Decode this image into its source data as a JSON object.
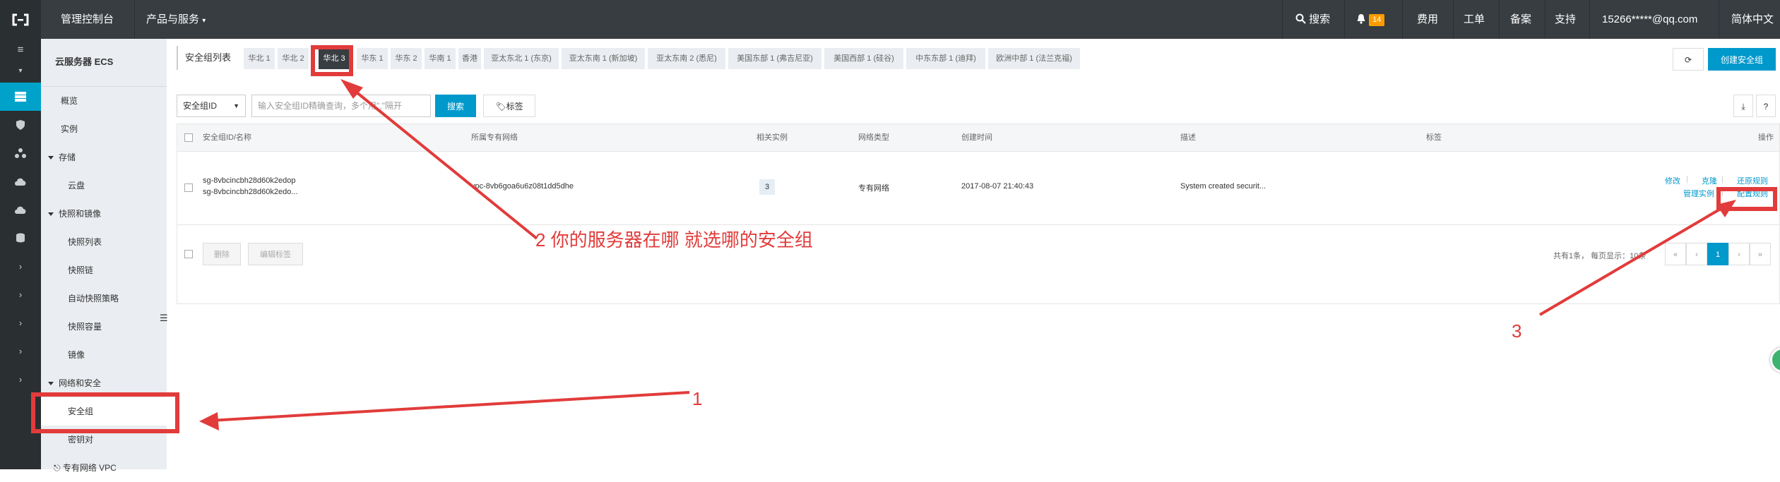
{
  "topbar": {
    "console": "管理控制台",
    "products": "产品与服务",
    "search": "搜索",
    "notifications_count": "14",
    "billing": "费用",
    "tickets": "工单",
    "icp": "备案",
    "support": "支持",
    "account": "15266*****@qq.com",
    "language": "简体中文"
  },
  "sidebar": {
    "title": "云服务器 ECS",
    "items": [
      {
        "label": "概览",
        "indent": 1
      },
      {
        "label": "实例",
        "indent": 1
      },
      {
        "label": "存储",
        "indent": 0,
        "group": true
      },
      {
        "label": "云盘",
        "indent": 2
      },
      {
        "label": "快照和镜像",
        "indent": 0,
        "group": true
      },
      {
        "label": "快照列表",
        "indent": 2
      },
      {
        "label": "快照链",
        "indent": 2
      },
      {
        "label": "自动快照策略",
        "indent": 2
      },
      {
        "label": "快照容量",
        "indent": 2
      },
      {
        "label": "镜像",
        "indent": 2
      },
      {
        "label": "网络和安全",
        "indent": 0,
        "group": true
      },
      {
        "label": "安全组",
        "indent": 2
      },
      {
        "label": "密钥对",
        "indent": 2
      },
      {
        "label": "专有网络 VPC",
        "indent": 2
      }
    ]
  },
  "region_bar": {
    "title": "安全组列表",
    "tabs": [
      "华北 1",
      "华北 2",
      "华北 3",
      "华东 1",
      "华东 2",
      "华南 1",
      "香港",
      "亚太东北 1 (东京)",
      "亚太东南 1 (新加坡)",
      "亚太东南 2 (悉尼)",
      "美国东部 1 (弗吉尼亚)",
      "美国西部 1 (硅谷)",
      "中东东部 1 (迪拜)",
      "欧洲中部 1 (法兰克福)"
    ],
    "active_tab": "华北 3",
    "refresh_icon": "refresh-icon",
    "create_button": "创建安全组"
  },
  "filters": {
    "select_value": "安全组ID",
    "search_placeholder": "输入安全组ID精确查询，多个用\",\"隔开",
    "search_button": "搜索",
    "tag_button": "标签"
  },
  "table": {
    "columns": [
      "安全组ID/名称",
      "所属专有网络",
      "相关实例",
      "网络类型",
      "创建时间",
      "描述",
      "标签",
      "操作"
    ],
    "rows": [
      {
        "id": "sg-8vbcincbh28d60k2edop",
        "name": "sg-8vbcincbh28d60k2edo...",
        "vpc": "vpc-8vb6goa6u6z08t1dd5dhe",
        "instances": "3",
        "network_type": "专有网络",
        "created": "2017-08-07 21:40:43",
        "description": "System created securit...",
        "tags": "",
        "actions": [
          "修改",
          "克隆",
          "还原规则",
          "管理实例",
          "配置规则"
        ]
      }
    ],
    "footer_buttons": [
      "删除",
      "编辑标签"
    ],
    "summary": "共有1条， 每页显示：10条",
    "pager": [
      "«",
      "‹",
      "1",
      "›",
      "»"
    ],
    "current_page": "1"
  },
  "annotations": {
    "label_1": "1",
    "label_2": "2 你的服务器在哪  就选哪的安全组",
    "label_3": "3",
    "color": "#e23b3b"
  }
}
